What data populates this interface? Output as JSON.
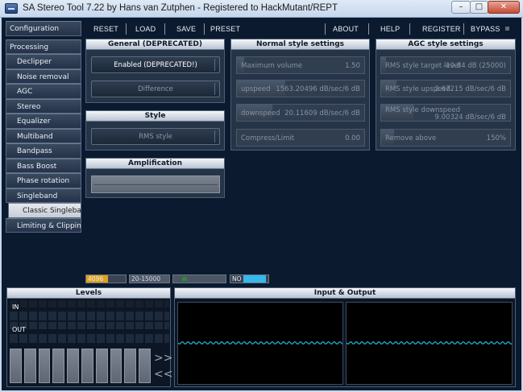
{
  "window": {
    "title": "SA Stereo Tool 7.22 by Hans van Zutphen - Registered to HackMutant/REPT",
    "minimize_glyph": "–",
    "maximize_glyph": "□",
    "close_glyph": "✕"
  },
  "menu": {
    "reset": "RESET",
    "load": "LOAD",
    "save": "SAVE",
    "preset": "PRESET",
    "about": "ABOUT",
    "help": "HELP",
    "register": "REGISTER",
    "bypass": "BYPASS"
  },
  "sidebar": {
    "configuration": "Configuration",
    "processing": "Processing",
    "items": [
      "Declipper",
      "Noise removal",
      "AGC",
      "Stereo",
      "Equalizer",
      "Multiband",
      "Bandpass",
      "Bass Boost",
      "Phase rotation",
      "Singleband"
    ],
    "selected": "Classic Singleband",
    "last": "Limiting & Clipping"
  },
  "general": {
    "title": "General (DEPRECATED)",
    "enabled_button": "Enabled (DEPRECATED!)",
    "difference_button": "Difference"
  },
  "style": {
    "title": "Style",
    "rms_button": "RMS style"
  },
  "amplification": {
    "title": "Amplification"
  },
  "normal": {
    "title": "Normal style settings",
    "sliders": [
      {
        "label": "Maximum volume",
        "value": "1.50",
        "fill": 0.06
      },
      {
        "label": "upspeed",
        "value": "1563.20496 dB/sec/6 dB",
        "fill": 0.38
      },
      {
        "label": "downspeed",
        "value": "20.11609 dB/sec/6 dB",
        "fill": 0.28
      },
      {
        "label": "Compress/Limit",
        "value": "0.00",
        "fill": 0.0
      }
    ]
  },
  "agc": {
    "title": "AGC style settings",
    "sliders": [
      {
        "label": "RMS style target level",
        "value": "-10.84 dB (25000)",
        "fill": 0.04
      },
      {
        "label": "RMS style upspeed",
        "value": "2.67215 dB/sec/6 dB",
        "fill": 0.12
      },
      {
        "label": "RMS style downspeed",
        "value": "9.00324 dB/sec/6 dB",
        "fill": 0.25
      },
      {
        "label": "Remove above",
        "value": "150%",
        "fill": 0.1
      }
    ]
  },
  "status": {
    "buffer": "4096",
    "buffer_fill": 0.55,
    "freq": "20-15000 Hz",
    "mode": "NO",
    "mode_fill": 0.6,
    "colors": {
      "buffer": "#e0a21a",
      "mode": "#35b8ea",
      "indicator": "#2c8a2c"
    }
  },
  "levels": {
    "title": "Levels",
    "in_label": "IN",
    "out_label": "OUT",
    "up_arrow": ">>",
    "down_arrow": "<<"
  },
  "io": {
    "title": "Input & Output",
    "wave_color": "#26b6d8"
  }
}
